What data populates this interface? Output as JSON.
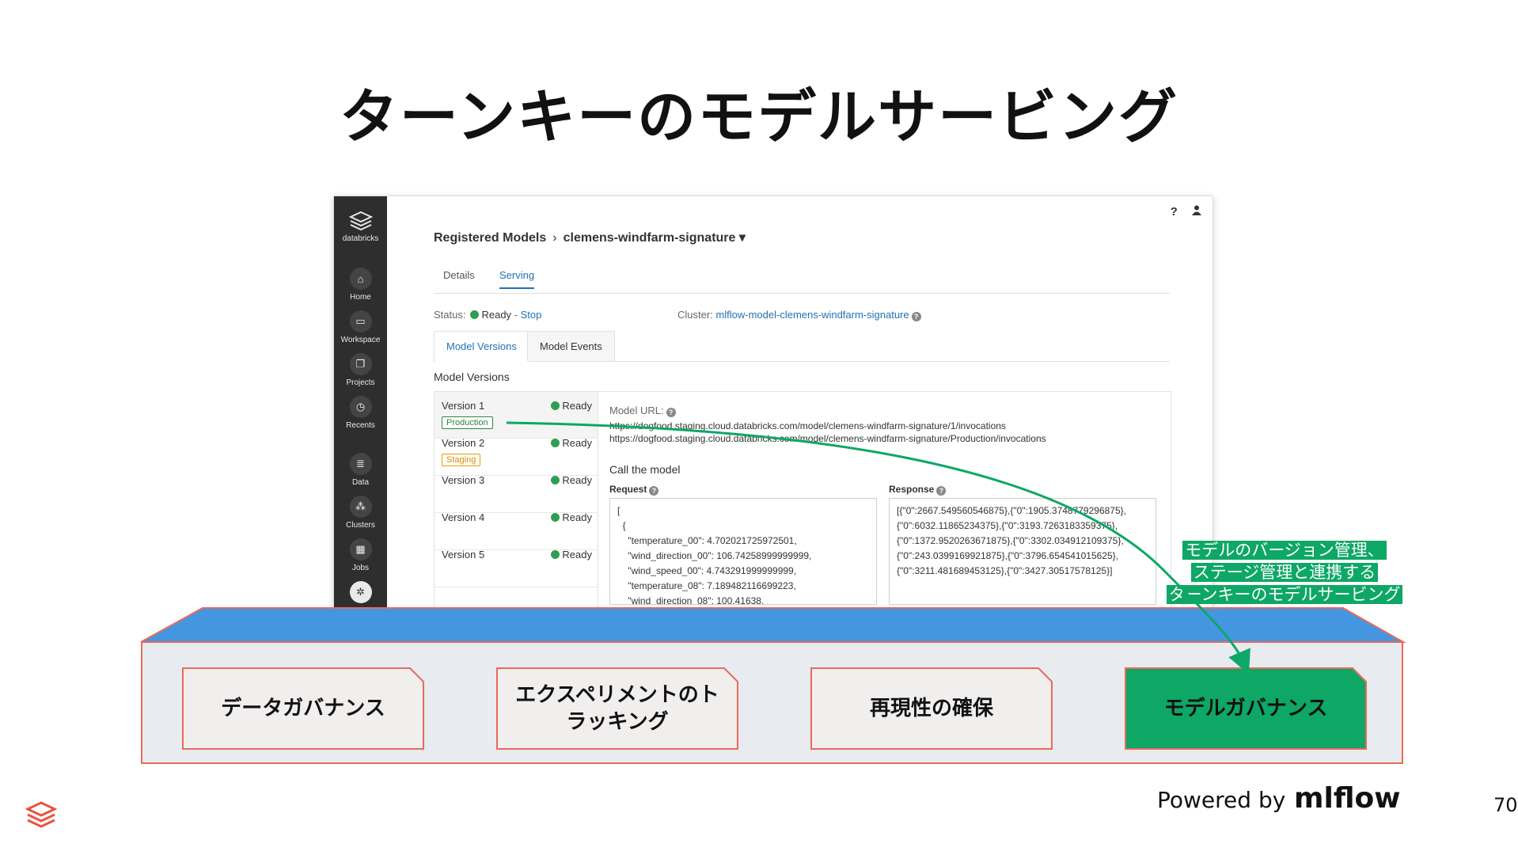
{
  "slide": {
    "title": "ターンキーのモデルサービング",
    "page_number": "70",
    "powered_by": "Powered by",
    "mlflow_logo_text": "mlflow"
  },
  "sidebar": {
    "brand": "databricks",
    "items": [
      {
        "label": "Home",
        "icon": "home-icon"
      },
      {
        "label": "Workspace",
        "icon": "folder-icon"
      },
      {
        "label": "Projects",
        "icon": "projects-icon"
      },
      {
        "label": "Recents",
        "icon": "clock-icon"
      },
      {
        "label": "Data",
        "icon": "database-icon"
      },
      {
        "label": "Clusters",
        "icon": "clusters-icon"
      },
      {
        "label": "Jobs",
        "icon": "calendar-icon"
      }
    ]
  },
  "header": {
    "help": "?",
    "breadcrumb_root": "Registered Models",
    "breadcrumb_sep": "›",
    "model_name": "clemens-windfarm-signature ▾"
  },
  "tabs": [
    {
      "label": "Details",
      "active": false
    },
    {
      "label": "Serving",
      "active": true
    }
  ],
  "status": {
    "label": "Status:",
    "value": "Ready",
    "dash": " - ",
    "stop_link": "Stop",
    "cluster_label": "Cluster:",
    "cluster_value": "mlflow-model-clemens-windfarm-signature"
  },
  "subtabs": [
    {
      "label": "Model Versions",
      "active": true
    },
    {
      "label": "Model Events",
      "active": false
    }
  ],
  "versions_title": "Model Versions",
  "versions": [
    {
      "name": "Version 1",
      "status": "Ready",
      "badge": "Production"
    },
    {
      "name": "Version 2",
      "status": "Ready",
      "badge": "Staging"
    },
    {
      "name": "Version 3",
      "status": "Ready",
      "badge": ""
    },
    {
      "name": "Version 4",
      "status": "Ready",
      "badge": ""
    },
    {
      "name": "Version 5",
      "status": "Ready",
      "badge": ""
    }
  ],
  "detail": {
    "model_url_label": "Model URL:",
    "url1": "https://dogfood.staging.cloud.databricks.com/model/clemens-windfarm-signature/1/invocations",
    "url2": "https://dogfood.staging.cloud.databricks.com/model/clemens-windfarm-signature/Production/invocations",
    "call_title": "Call the model",
    "request_label": "Request",
    "response_label": "Response",
    "request_body": "[\n  {\n    \"temperature_00\": 4.702021725972501,\n    \"wind_direction_00\": 106.74258999999999,\n    \"wind_speed_00\": 4.743291999999999,\n    \"temperature_08\": 7.189482116699223,\n    \"wind_direction_08\": 100.41638,",
    "response_body": "[{\"0\":2667.549560546875},{\"0\":1905.3748779296875},\n{\"0\":6032.11865234375},{\"0\":3193.7263183359375},\n{\"0\":1372.9520263671875},{\"0\":3302.034912109375},\n{\"0\":243.0399169921875},{\"0\":3796.654541015625},\n{\"0\":3211.481689453125},{\"0\":3427.30517578125}]"
  },
  "callout": {
    "line1": "モデルのバージョン管理、",
    "line2": "ステージ管理と連携する",
    "line3": "ターンキーのモデルサービング"
  },
  "cards": [
    {
      "line1": "データガバナンス",
      "line2": "",
      "highlight": false
    },
    {
      "line1": "エクスペリメントのト",
      "line2": "ラッキング",
      "highlight": false
    },
    {
      "line1": "再現性の確保",
      "line2": "",
      "highlight": false
    },
    {
      "line1": "モデルガバナンス",
      "line2": "",
      "highlight": true
    }
  ],
  "colors": {
    "accent_green": "#0ea766",
    "box_blue": "#4596e0",
    "box_border": "#e86a5b",
    "card_fill": "#f1eeee",
    "link_blue": "#2272b4"
  }
}
